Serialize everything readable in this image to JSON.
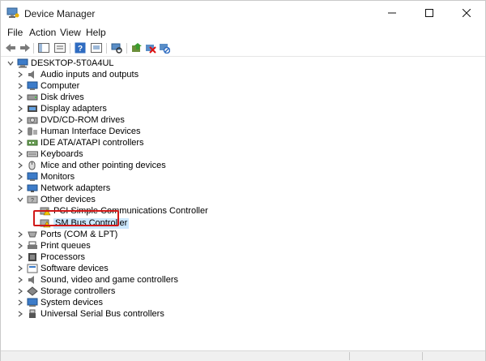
{
  "window": {
    "title": "Device Manager"
  },
  "menu": [
    "File",
    "Action",
    "View",
    "Help"
  ],
  "toolbar": [
    "back-arrow-icon",
    "forward-arrow-icon",
    "show-hide-console-tree-icon",
    "properties-icon",
    "help-icon",
    "show-view-icon",
    "scan-hardware-icon",
    "update-driver-icon",
    "uninstall-device-icon",
    "disable-device-icon"
  ],
  "tree": {
    "root": "DESKTOP-5T0A4UL",
    "items": [
      {
        "label": "Audio inputs and outputs",
        "icon": "speaker-icon"
      },
      {
        "label": "Computer",
        "icon": "monitor-icon"
      },
      {
        "label": "Disk drives",
        "icon": "disk-drive-icon"
      },
      {
        "label": "Display adapters",
        "icon": "display-adapter-icon"
      },
      {
        "label": "DVD/CD-ROM drives",
        "icon": "dvd-drive-icon"
      },
      {
        "label": "Human Interface Devices",
        "icon": "hid-icon"
      },
      {
        "label": "IDE ATA/ATAPI controllers",
        "icon": "ide-controller-icon"
      },
      {
        "label": "Keyboards",
        "icon": "keyboard-icon"
      },
      {
        "label": "Mice and other pointing devices",
        "icon": "mouse-icon"
      },
      {
        "label": "Monitors",
        "icon": "monitor-icon"
      },
      {
        "label": "Network adapters",
        "icon": "network-adapter-icon"
      },
      {
        "label": "Other devices",
        "icon": "other-devices-icon",
        "expanded": true
      },
      {
        "label": "PCI Simple Communications Controller",
        "icon": "warning-device-icon",
        "child": true
      },
      {
        "label": "SM Bus Controller",
        "icon": "warning-device-icon",
        "child": true,
        "selected": true
      },
      {
        "label": "Ports (COM & LPT)",
        "icon": "port-icon"
      },
      {
        "label": "Print queues",
        "icon": "printer-icon"
      },
      {
        "label": "Processors",
        "icon": "processor-icon"
      },
      {
        "label": "Software devices",
        "icon": "software-device-icon"
      },
      {
        "label": "Sound, video and game controllers",
        "icon": "speaker-icon"
      },
      {
        "label": "Storage controllers",
        "icon": "storage-controller-icon"
      },
      {
        "label": "System devices",
        "icon": "system-devices-icon"
      },
      {
        "label": "Universal Serial Bus controllers",
        "icon": "usb-icon"
      }
    ]
  }
}
